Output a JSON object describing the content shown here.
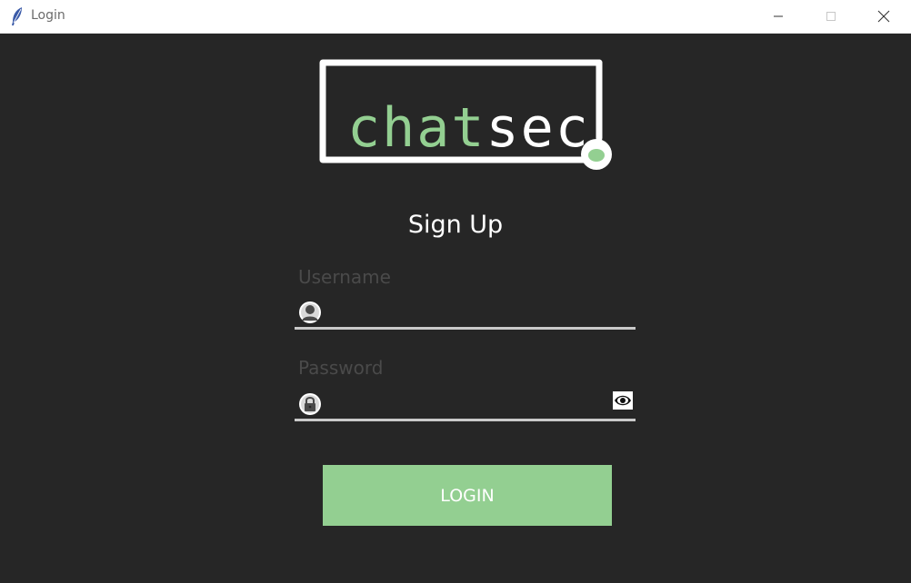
{
  "window": {
    "title": "Login",
    "app_icon": "feather-icon",
    "controls": [
      "minimize-icon",
      "maximize-icon",
      "close-icon"
    ]
  },
  "logo": {
    "text_part1": "chat",
    "text_part2": "sec",
    "part1_color": "#93cf91",
    "part2_color": "#ffffff"
  },
  "form": {
    "heading": "Sign Up",
    "username": {
      "label": "Username",
      "value": "",
      "icon": "user-icon"
    },
    "password": {
      "label": "Password",
      "value": "",
      "icon": "lock-icon",
      "toggle_icon": "eye-icon"
    },
    "submit_label": "LOGIN"
  },
  "colors": {
    "background": "#262626",
    "accent": "#93cf91",
    "label": "#4a4a4a",
    "underline": "#c9c9c9"
  }
}
